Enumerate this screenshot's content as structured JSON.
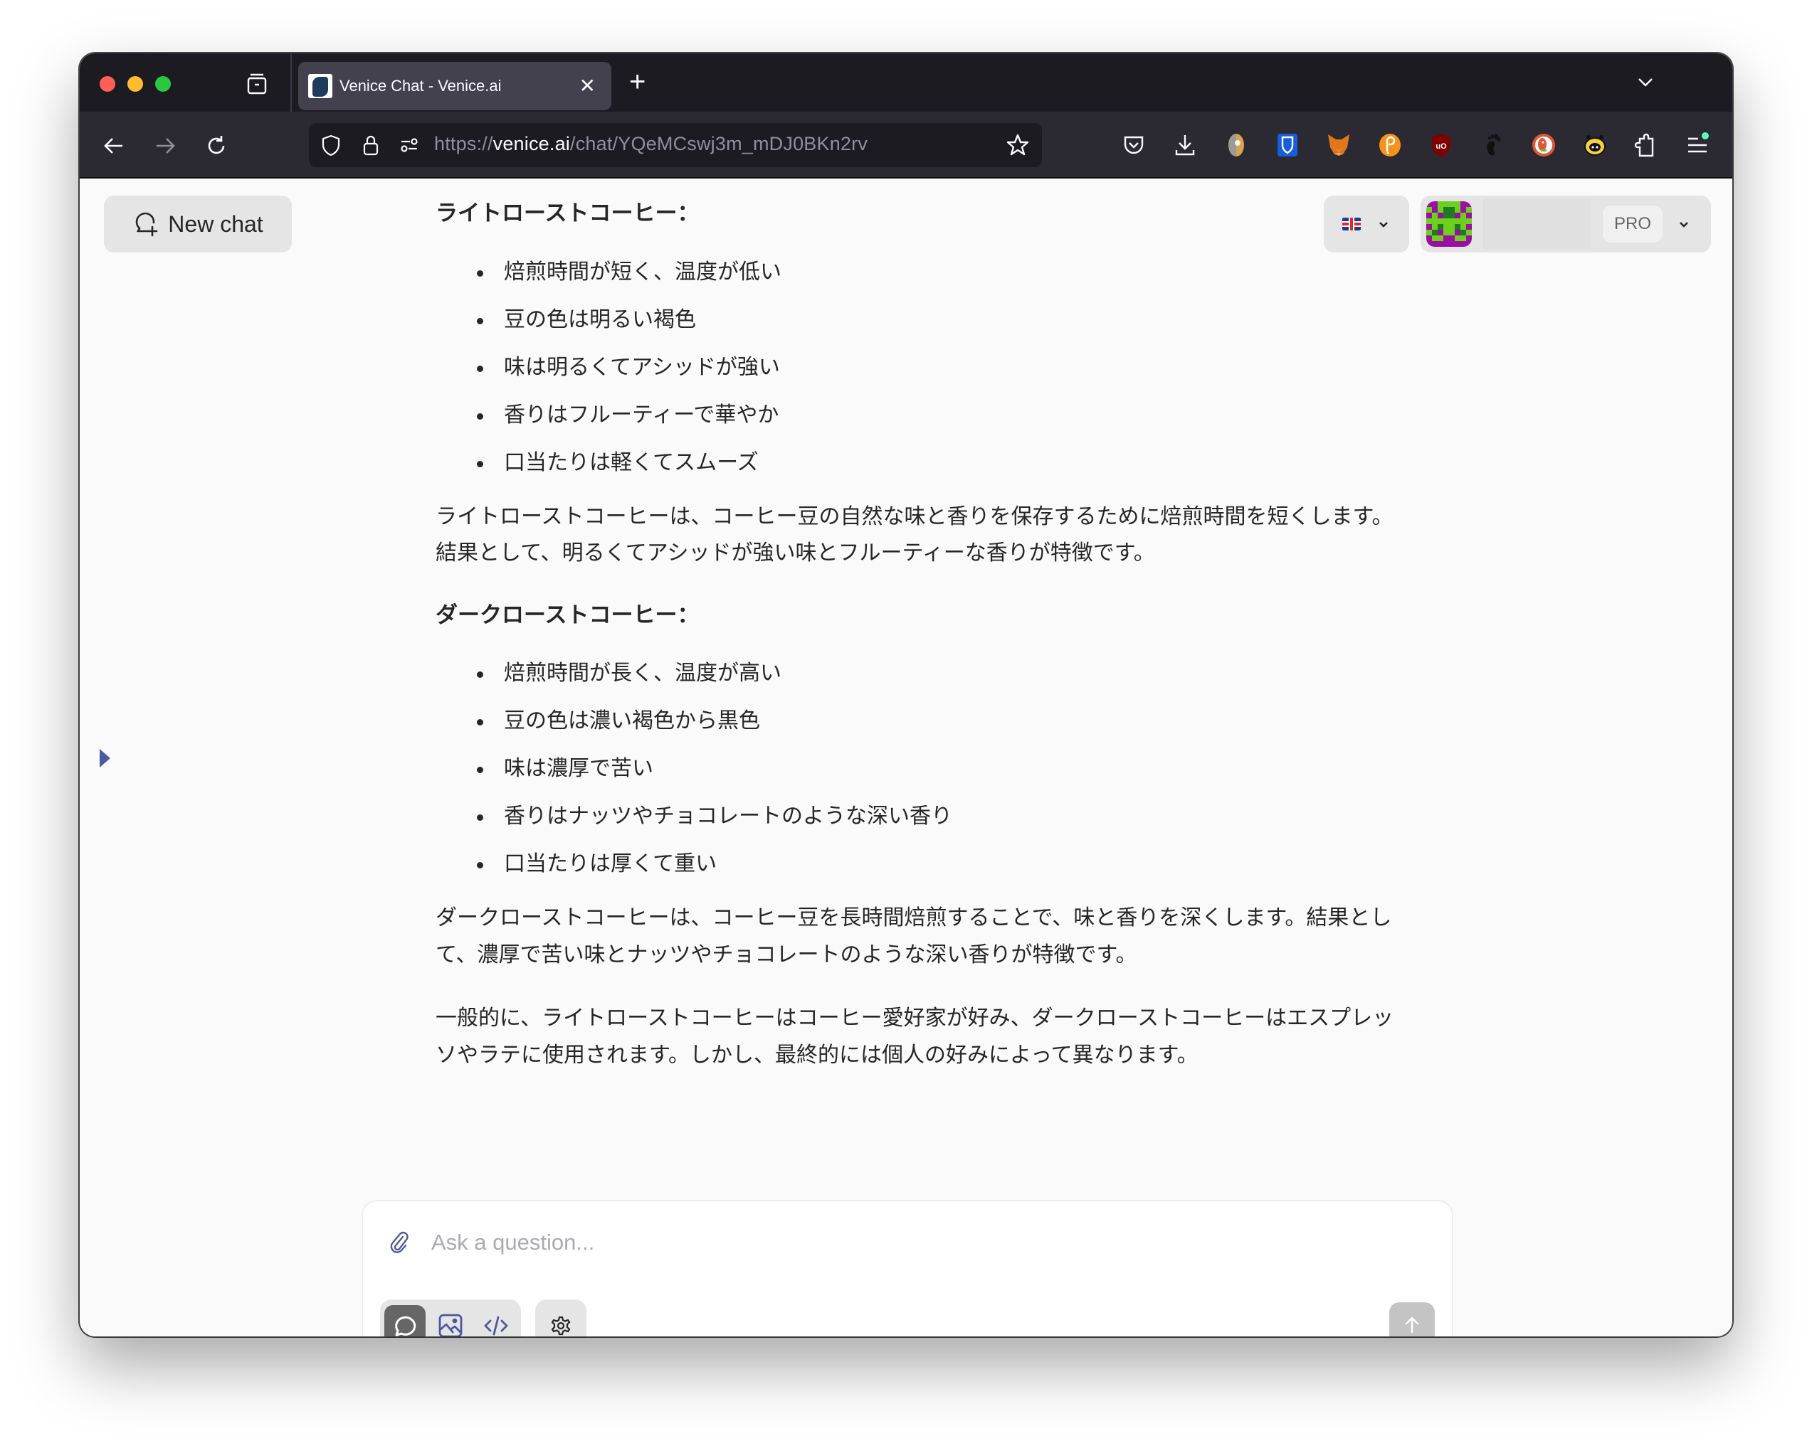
{
  "browser": {
    "tab_title": "Venice Chat - Venice.ai",
    "url_scheme": "https://",
    "url_host": "venice.ai",
    "url_path": "/chat/YQeMCswj3m_mDJ0BKn2rv",
    "extensions": [
      "pocket-icon",
      "download-icon",
      "extension-avatar-icon",
      "bitwarden-icon",
      "metamask-icon",
      "polkadot-icon",
      "ublock-origin-icon",
      "gnome-foot-icon",
      "duckduckgo-icon",
      "yellow-creature-extension-icon",
      "extensions-puzzle-icon",
      "app-menu-icon"
    ]
  },
  "header": {
    "new_chat_label": "New chat",
    "language": "en-GB",
    "plan_badge": "PRO"
  },
  "message": {
    "light_heading": "ライトローストコーヒー：",
    "light_points": [
      "焙煎時間が短く、温度が低い",
      "豆の色は明るい褐色",
      "味は明るくてアシッドが強い",
      "香りはフルーティーで華やか",
      "口当たりは軽くてスムーズ"
    ],
    "light_summary": "ライトローストコーヒーは、コーヒー豆の自然な味と香りを保存するために焙煎時間を短くします。結果として、明るくてアシッドが強い味とフルーティーな香りが特徴です。",
    "dark_heading": "ダークローストコーヒー：",
    "dark_points": [
      "焙煎時間が長く、温度が高い",
      "豆の色は濃い褐色から黒色",
      "味は濃厚で苦い",
      "香りはナッツやチョコレートのような深い香り",
      "口当たりは厚くて重い"
    ],
    "dark_summary": "ダークローストコーヒーは、コーヒー豆を長時間焙煎することで、味と香りを深くします。結果として、濃厚で苦い味とナッツやチョコレートのような深い香りが特徴です。",
    "conclusion": "一般的に、ライトローストコーヒーはコーヒー愛好家が好み、ダークローストコーヒーはエスプレッソやラテに使用されます。しかし、最終的には個人の好みによって異なります。"
  },
  "composer": {
    "placeholder": "Ask a question...",
    "value": "",
    "modes": [
      "text",
      "image",
      "code"
    ],
    "active_mode": "text"
  },
  "colors": {
    "accent": "#4c5a9c",
    "active_mode_bg": "#666666",
    "send_disabled": "#c4c4c4"
  }
}
